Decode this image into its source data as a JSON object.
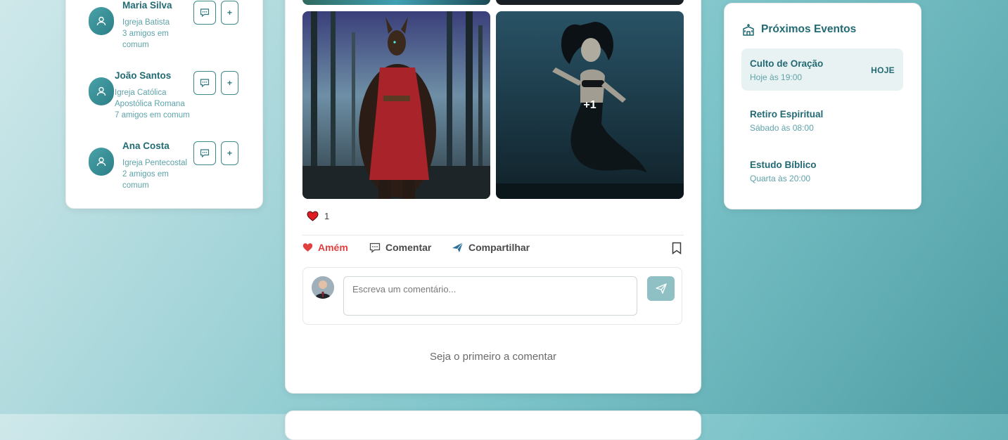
{
  "suggestions": [
    {
      "name": "Maria Silva",
      "church": "Igreja Batista",
      "mutual": "3 amigos em comum"
    },
    {
      "name": "João Santos",
      "church": "Igreja Católica Apostólica Romana",
      "mutual": "7 amigos em comum"
    },
    {
      "name": "Ana Costa",
      "church": "Igreja Pentecostal",
      "mutual": "2 amigos em comum"
    }
  ],
  "suggestion_actions": {
    "add_label": "+",
    "message_icon": "message-icon"
  },
  "post": {
    "more_images_label": "+1",
    "likes_count": "1",
    "actions": {
      "amen": "Amém",
      "comment": "Comentar",
      "share": "Compartilhar"
    },
    "comment_placeholder": "Escreva um comentário...",
    "empty_comments": "Seja o primeiro a comentar"
  },
  "events": {
    "title": "Próximos Eventos",
    "items": [
      {
        "name": "Culto de Oração",
        "time": "Hoje às 19:00",
        "badge": "HOJE"
      },
      {
        "name": "Retiro Espiritual",
        "time": "Sábado às 08:00"
      },
      {
        "name": "Estudo Bíblico",
        "time": "Quarta às 20:00"
      }
    ]
  },
  "colors": {
    "accent": "#226a73",
    "amen": "#e0403f",
    "send": "#8ec0c4"
  }
}
